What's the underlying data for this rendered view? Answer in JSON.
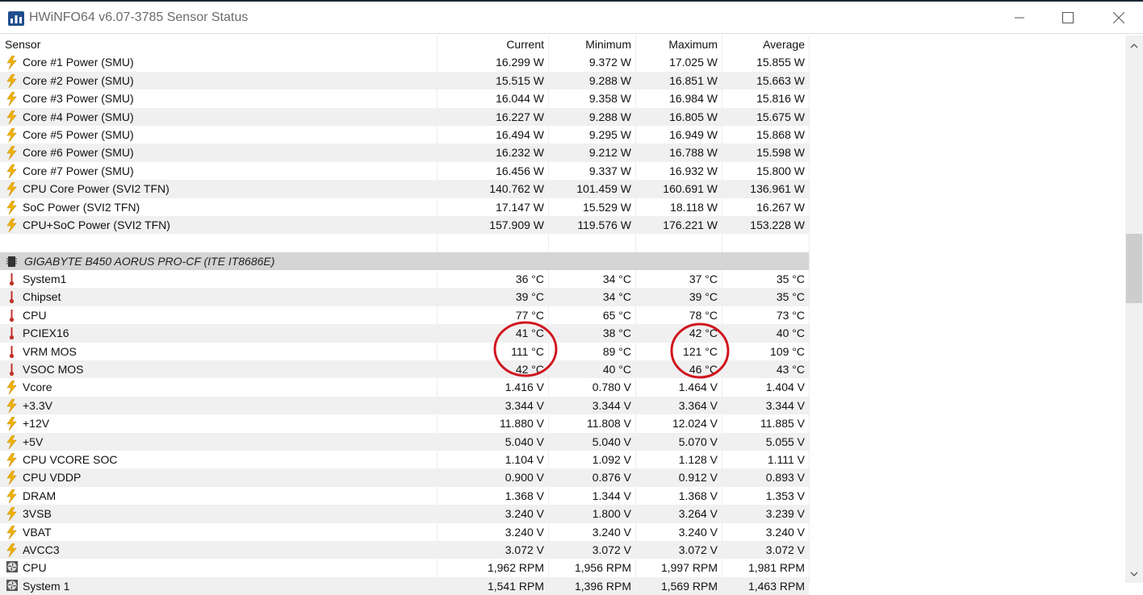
{
  "window": {
    "title": "HWiNFO64 v6.07-3785 Sensor Status",
    "controls": {
      "minimize": "—",
      "maximize": "☐",
      "close": "✕"
    }
  },
  "table": {
    "headers": [
      "Sensor",
      "Current",
      "Minimum",
      "Maximum",
      "Average"
    ],
    "rows": [
      {
        "icon": "power-icon",
        "name": "Core #1 Power (SMU)",
        "current": "16.299 W",
        "min": "9.372 W",
        "max": "17.025 W",
        "avg": "15.855 W"
      },
      {
        "icon": "power-icon",
        "name": "Core #2 Power (SMU)",
        "current": "15.515 W",
        "min": "9.288 W",
        "max": "16.851 W",
        "avg": "15.663 W"
      },
      {
        "icon": "power-icon",
        "name": "Core #3 Power (SMU)",
        "current": "16.044 W",
        "min": "9.358 W",
        "max": "16.984 W",
        "avg": "15.816 W"
      },
      {
        "icon": "power-icon",
        "name": "Core #4 Power (SMU)",
        "current": "16.227 W",
        "min": "9.288 W",
        "max": "16.805 W",
        "avg": "15.675 W"
      },
      {
        "icon": "power-icon",
        "name": "Core #5 Power (SMU)",
        "current": "16.494 W",
        "min": "9.295 W",
        "max": "16.949 W",
        "avg": "15.868 W"
      },
      {
        "icon": "power-icon",
        "name": "Core #6 Power (SMU)",
        "current": "16.232 W",
        "min": "9.212 W",
        "max": "16.788 W",
        "avg": "15.598 W"
      },
      {
        "icon": "power-icon",
        "name": "Core #7 Power (SMU)",
        "current": "16.456 W",
        "min": "9.337 W",
        "max": "16.932 W",
        "avg": "15.800 W"
      },
      {
        "icon": "power-icon",
        "name": "CPU Core Power (SVI2 TFN)",
        "current": "140.762 W",
        "min": "101.459 W",
        "max": "160.691 W",
        "avg": "136.961 W"
      },
      {
        "icon": "power-icon",
        "name": "SoC Power (SVI2 TFN)",
        "current": "17.147 W",
        "min": "15.529 W",
        "max": "18.118 W",
        "avg": "16.267 W"
      },
      {
        "icon": "power-icon",
        "name": "CPU+SoC Power (SVI2 TFN)",
        "current": "157.909 W",
        "min": "119.576 W",
        "max": "176.221 W",
        "avg": "153.228 W"
      },
      {
        "icon": "",
        "name": "",
        "current": "",
        "min": "",
        "max": "",
        "avg": ""
      },
      {
        "icon": "chip-icon",
        "name": "GIGABYTE B450 AORUS PRO-CF (ITE IT8686E)",
        "current": "",
        "min": "",
        "max": "",
        "avg": "",
        "section": true
      },
      {
        "icon": "thermometer-icon",
        "name": "System1",
        "current": "36 °C",
        "min": "34 °C",
        "max": "37 °C",
        "avg": "35 °C"
      },
      {
        "icon": "thermometer-icon",
        "name": "Chipset",
        "current": "39 °C",
        "min": "34 °C",
        "max": "39 °C",
        "avg": "35 °C"
      },
      {
        "icon": "thermometer-icon",
        "name": "CPU",
        "current": "77 °C",
        "min": "65 °C",
        "max": "78 °C",
        "avg": "73 °C"
      },
      {
        "icon": "thermometer-icon",
        "name": "PCIEX16",
        "current": "41 °C",
        "min": "38 °C",
        "max": "42 °C",
        "avg": "40 °C"
      },
      {
        "icon": "thermometer-icon",
        "name": "VRM MOS",
        "current": "111 °C",
        "min": "89 °C",
        "max": "121 °C",
        "avg": "109 °C"
      },
      {
        "icon": "thermometer-icon",
        "name": "VSOC MOS",
        "current": "42 °C",
        "min": "40 °C",
        "max": "46 °C",
        "avg": "43 °C"
      },
      {
        "icon": "power-icon",
        "name": "Vcore",
        "current": "1.416 V",
        "min": "0.780 V",
        "max": "1.464 V",
        "avg": "1.404 V"
      },
      {
        "icon": "power-icon",
        "name": "+3.3V",
        "current": "3.344 V",
        "min": "3.344 V",
        "max": "3.364 V",
        "avg": "3.344 V"
      },
      {
        "icon": "power-icon",
        "name": "+12V",
        "current": "11.880 V",
        "min": "11.808 V",
        "max": "12.024 V",
        "avg": "11.885 V"
      },
      {
        "icon": "power-icon",
        "name": "+5V",
        "current": "5.040 V",
        "min": "5.040 V",
        "max": "5.070 V",
        "avg": "5.055 V"
      },
      {
        "icon": "power-icon",
        "name": "CPU VCORE SOC",
        "current": "1.104 V",
        "min": "1.092 V",
        "max": "1.128 V",
        "avg": "1.111 V"
      },
      {
        "icon": "power-icon",
        "name": "CPU VDDP",
        "current": "0.900 V",
        "min": "0.876 V",
        "max": "0.912 V",
        "avg": "0.893 V"
      },
      {
        "icon": "power-icon",
        "name": "DRAM",
        "current": "1.368 V",
        "min": "1.344 V",
        "max": "1.368 V",
        "avg": "1.353 V"
      },
      {
        "icon": "power-icon",
        "name": "3VSB",
        "current": "3.240 V",
        "min": "1.800 V",
        "max": "3.264 V",
        "avg": "3.239 V"
      },
      {
        "icon": "power-icon",
        "name": "VBAT",
        "current": "3.240 V",
        "min": "3.240 V",
        "max": "3.240 V",
        "avg": "3.240 V"
      },
      {
        "icon": "power-icon",
        "name": "AVCC3",
        "current": "3.072 V",
        "min": "3.072 V",
        "max": "3.072 V",
        "avg": "3.072 V"
      },
      {
        "icon": "fan-icon",
        "name": "CPU",
        "current": "1,962 RPM",
        "min": "1,956 RPM",
        "max": "1,997 RPM",
        "avg": "1,981 RPM"
      },
      {
        "icon": "fan-icon",
        "name": "System 1",
        "current": "1,541 RPM",
        "min": "1,396 RPM",
        "max": "1,569 RPM",
        "avg": "1,463 RPM"
      }
    ]
  },
  "colors": {
    "annotation": "#d0141e",
    "bolt": "#f0b400",
    "thermo": "#c0302a",
    "section_bg": "#d4d4d4"
  }
}
